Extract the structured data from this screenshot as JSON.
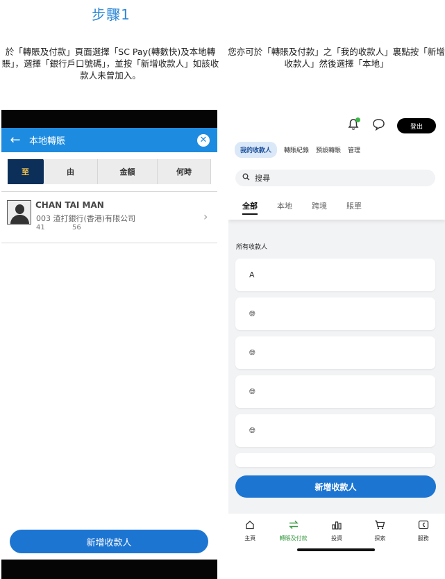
{
  "step_title": "步驟1",
  "left_description": "於「轉賬及付款」頁面選擇「SC Pay(轉數快)及本地轉賬」，選擇「銀行戶口號碼」，並按「新增收款人」如該收款人未曾加入。",
  "right_description": "您亦可於「轉賬及付款」之「我的收款人」裏點按「新增收款人」然後選擇「本地」",
  "left_phone": {
    "header_title": "本地轉賬",
    "back_icon": "back-arrow-icon",
    "close_icon": "close-icon",
    "steps": [
      "至",
      "由",
      "金額",
      "何時"
    ],
    "payee": {
      "name": "CHAN TAI MAN",
      "bank": "003 渣打銀行(香港)有限公司",
      "account_part1": "41",
      "account_part2": "56"
    },
    "add_payee_label": "新增收款人"
  },
  "right_phone": {
    "logout_label": "登出",
    "subnav": [
      "我的收款人",
      "轉賬紀錄",
      "預設轉賬",
      "管理"
    ],
    "search_placeholder": "搜尋",
    "tabs": [
      "全部",
      "本地",
      "跨境",
      "賬單"
    ],
    "section_label": "所有收款人",
    "cards": [
      "A",
      "",
      "",
      "",
      ""
    ],
    "add_payee_label": "新增收款人",
    "bottom_nav": [
      {
        "label": "主頁",
        "icon": "home-icon"
      },
      {
        "label": "轉賬及付款",
        "icon": "transfer-icon"
      },
      {
        "label": "投資",
        "icon": "invest-icon"
      },
      {
        "label": "探索",
        "icon": "cart-icon"
      },
      {
        "label": "服務",
        "icon": "service-icon"
      }
    ]
  },
  "colors": {
    "accent": "#1d75d2",
    "header_blue": "#1d8ce0",
    "step_active_bg": "#0c2f5a",
    "step_active_text": "#f2c14a",
    "nav_active": "#3b9b45"
  }
}
